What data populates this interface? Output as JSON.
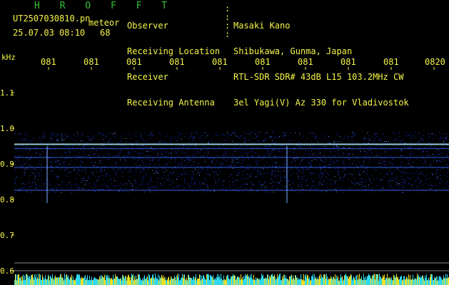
{
  "brand": "H R O F F T",
  "file": {
    "name": "UT2507030810.pn",
    "type_label": "meteor",
    "datetime": "25.07.03 08:10",
    "count": "68"
  },
  "meta": [
    {
      "label": "Observer",
      "value": "Masaki Kano"
    },
    {
      "label": "Receiving Location",
      "value": "Shibukawa, Gunma, Japan"
    },
    {
      "label": "Receiver",
      "value": "RTL-SDR SDR# 43dB L15 103.2MHz CW"
    },
    {
      "label": "Receiving Antenna",
      "value": "3el Yagi(V) Az 330 for Vladivostok"
    }
  ],
  "chart_data": {
    "type": "heatmap",
    "y_unit": "kHz",
    "y_ticks": [
      "1.1",
      "1.0",
      "0.9",
      "0.8",
      "0.7",
      "0.6"
    ],
    "x_ticks": [
      "081",
      "081",
      "081",
      "081",
      "081",
      "081",
      "081",
      "081",
      "081",
      "0820"
    ],
    "signal_lines_khz": [
      0.955,
      0.943,
      0.918,
      0.89,
      0.826
    ],
    "noise_band_khz": [
      0.82,
      0.99
    ],
    "vertical_bursts": [
      "0811",
      "0816"
    ],
    "colors": {
      "text": "#f4f44a",
      "brand": "#35c235",
      "signal": "#3a6dff",
      "hot": "#aaf0ff",
      "bar_cyan": "#2fd8f0",
      "bar_yellow": "#f0e020"
    }
  }
}
